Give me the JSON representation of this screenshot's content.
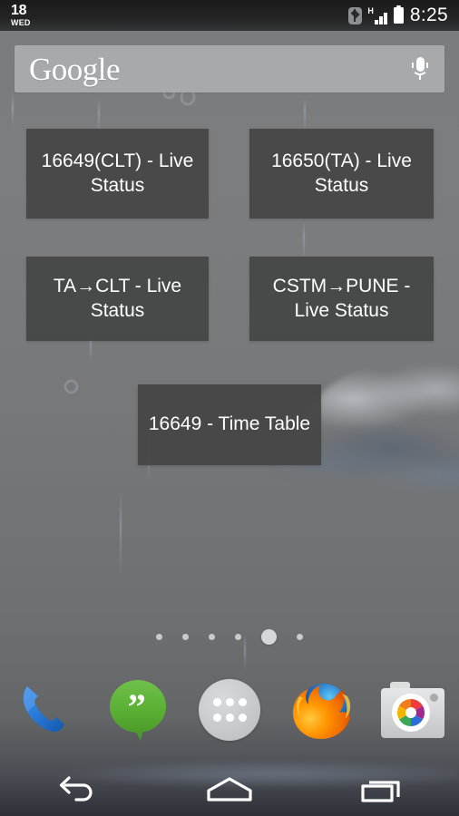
{
  "status_bar": {
    "date_number": "18",
    "date_day": "WED",
    "clock": "8:25",
    "network_type": "H",
    "icons": {
      "bluetooth": "bluetooth-icon",
      "signal": "signal-bars-icon",
      "battery": "battery-full-icon"
    }
  },
  "search": {
    "brand": "Google",
    "placeholder": "Google",
    "mic_label": "voice-search"
  },
  "widgets": [
    {
      "label": "16649(CLT) - Live Status"
    },
    {
      "label": "16650(TA) - Live Status"
    },
    {
      "label": "TA→CLT - Live Status"
    },
    {
      "label": "CSTM→PUNE - Live Status"
    },
    {
      "label": "16649 - Time Table"
    }
  ],
  "page_indicator": {
    "total": 6,
    "active_index": 4
  },
  "dock": [
    {
      "name": "phone",
      "label": "Phone"
    },
    {
      "name": "hangouts",
      "label": "Hangouts"
    },
    {
      "name": "app-drawer",
      "label": "Apps"
    },
    {
      "name": "firefox",
      "label": "Firefox"
    },
    {
      "name": "camera",
      "label": "Camera"
    }
  ],
  "nav_bar": [
    {
      "name": "back",
      "label": "Back"
    },
    {
      "name": "home",
      "label": "Home"
    },
    {
      "name": "recents",
      "label": "Recent apps"
    }
  ],
  "colors": {
    "widget_bg": "#454545",
    "widget_text": "#ffffff",
    "search_bg": "#ababad",
    "status_bg": "#1b1b1b",
    "wallpaper_top": "#7a7c7e",
    "wallpaper_bottom": "#2d3037",
    "hangouts_green": "#5cb034",
    "phone_blue": "#1f6fd0",
    "firefox_orange": "#e66000",
    "dot_active": "#d6d7d8"
  }
}
